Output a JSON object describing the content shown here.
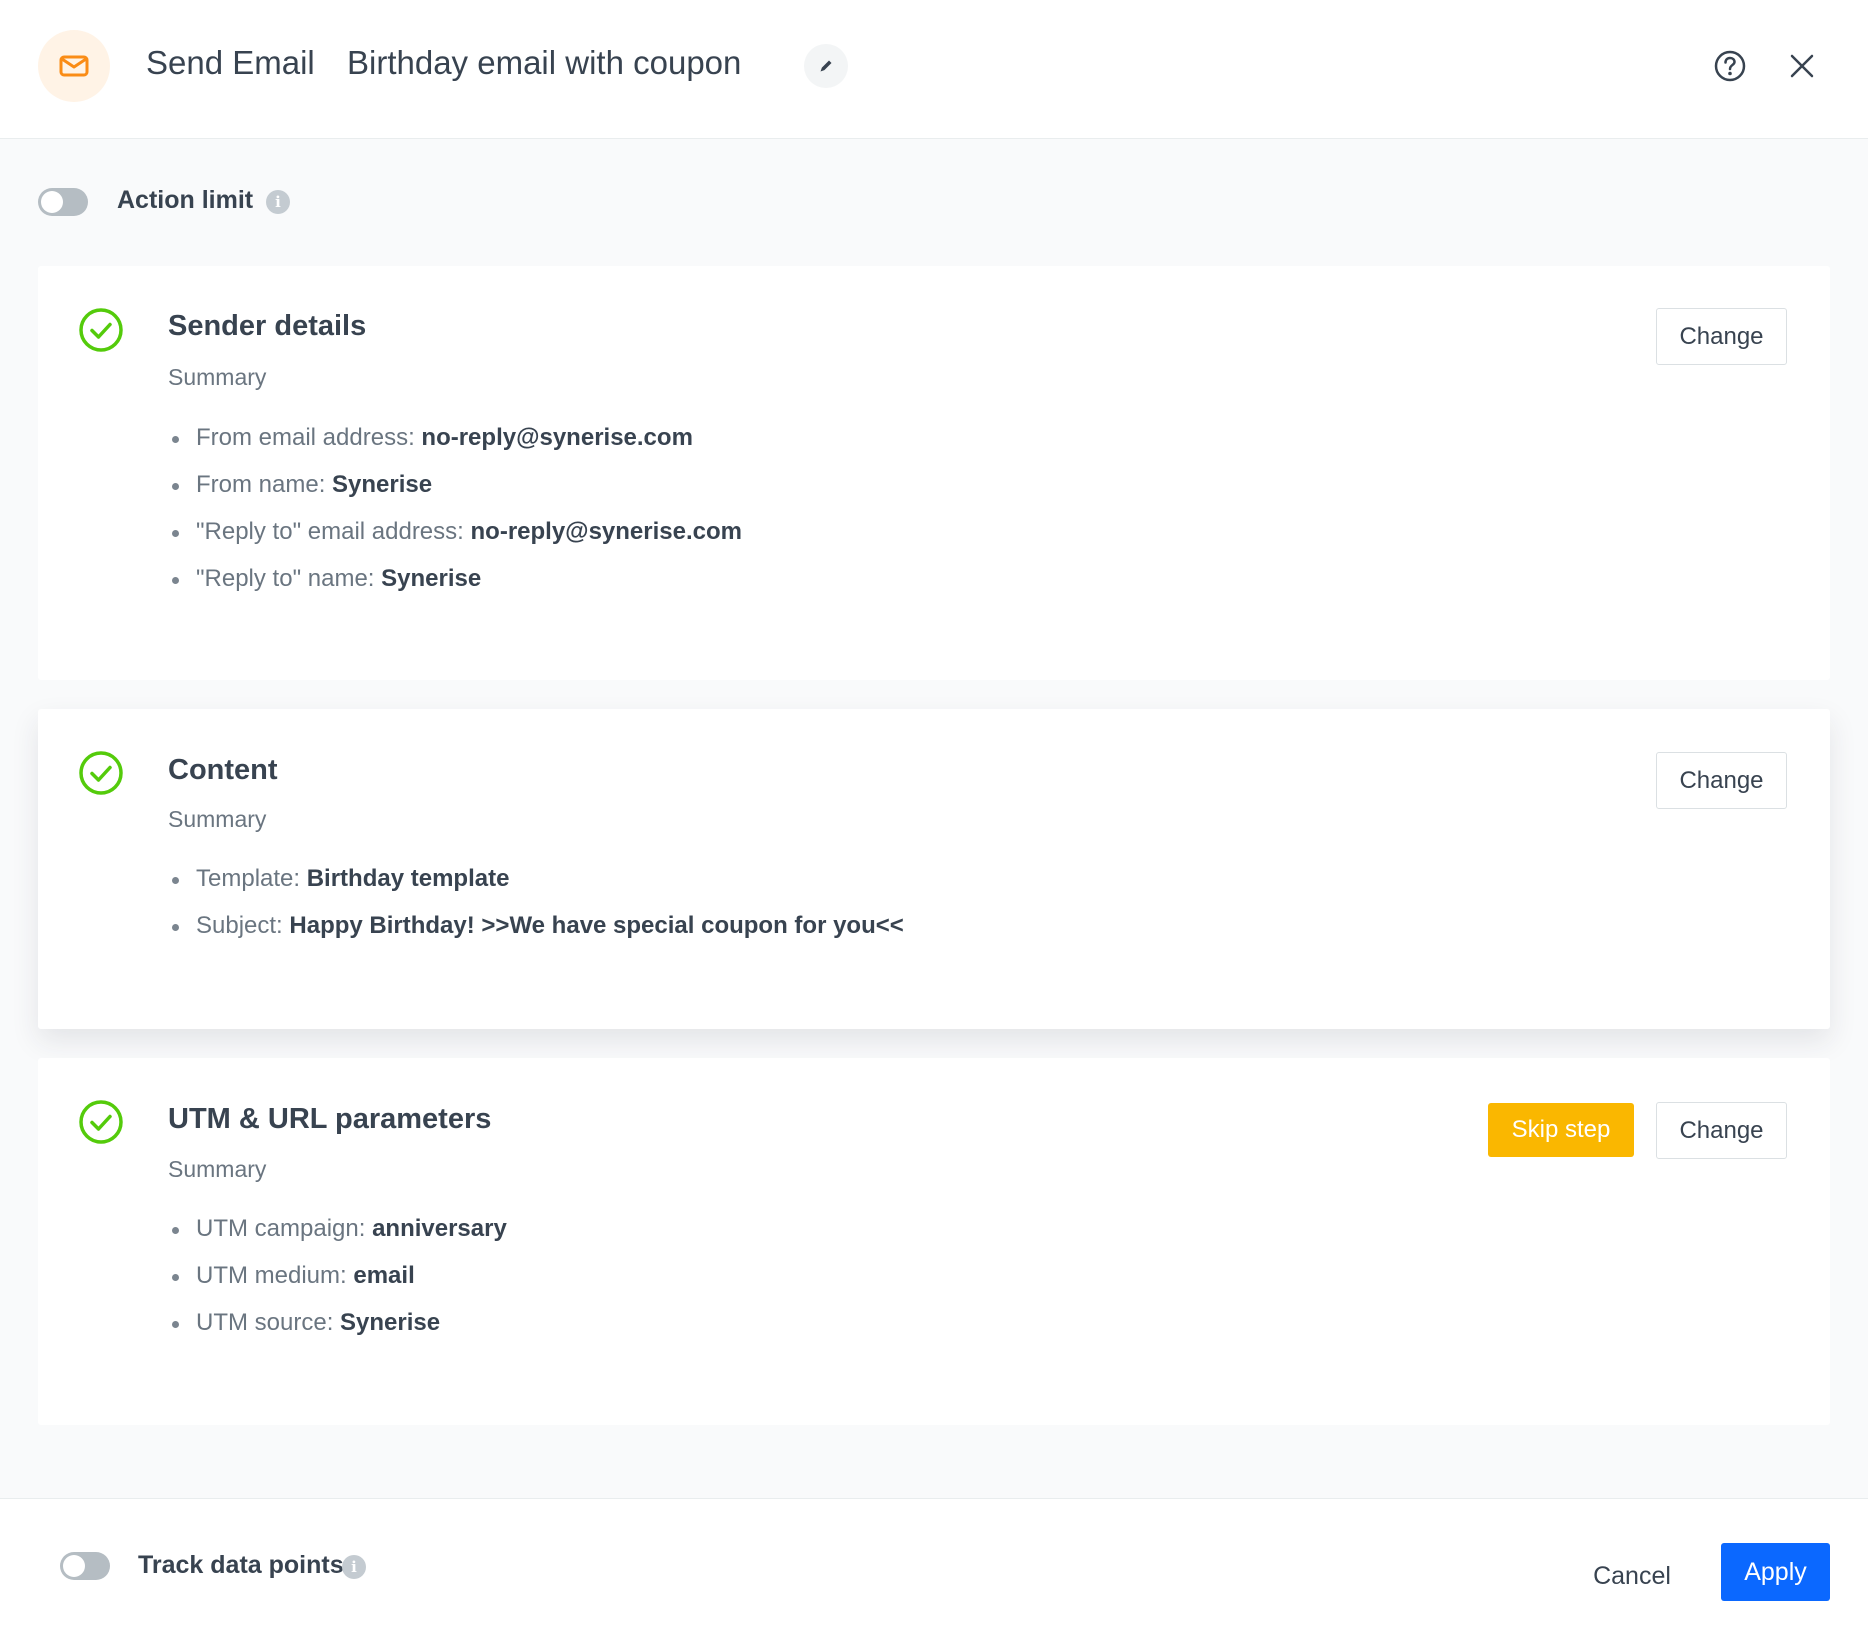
{
  "header": {
    "type_label": "Send Email",
    "name": "Birthday email with coupon",
    "icons": {
      "type": "envelope-icon",
      "edit": "pencil-icon",
      "help": "help-circle-icon",
      "close": "close-icon"
    }
  },
  "action_limit": {
    "label": "Action limit",
    "enabled": false
  },
  "colors": {
    "accent_orange": "#fa8c16",
    "success_green": "#54cb0b",
    "skip_yellow": "#fab700",
    "primary_blue": "#0b68ff"
  },
  "cards": [
    {
      "title": "Sender details",
      "subtitle": "Summary",
      "change_label": "Change",
      "items": [
        {
          "key": "From email address: ",
          "value": "no-reply@synerise.com"
        },
        {
          "key": "From name: ",
          "value": "Synerise"
        },
        {
          "key": "\"Reply to\" email address: ",
          "value": "no-reply@synerise.com"
        },
        {
          "key": "\"Reply to\" name: ",
          "value": "Synerise"
        }
      ]
    },
    {
      "title": "Content",
      "subtitle": "Summary",
      "change_label": "Change",
      "items": [
        {
          "key": "Template: ",
          "value": "Birthday template"
        },
        {
          "key": "Subject: ",
          "value": "Happy Birthday! >>We have special coupon for you<<"
        }
      ]
    },
    {
      "title": "UTM & URL parameters",
      "subtitle": "Summary",
      "skip_label": "Skip step",
      "change_label": "Change",
      "items": [
        {
          "key": "UTM campaign: ",
          "value": "anniversary"
        },
        {
          "key": "UTM medium: ",
          "value": "email"
        },
        {
          "key": "UTM source: ",
          "value": "Synerise"
        }
      ]
    }
  ],
  "footer": {
    "track_label": "Track data points",
    "track_enabled": false,
    "cancel_label": "Cancel",
    "apply_label": "Apply"
  }
}
